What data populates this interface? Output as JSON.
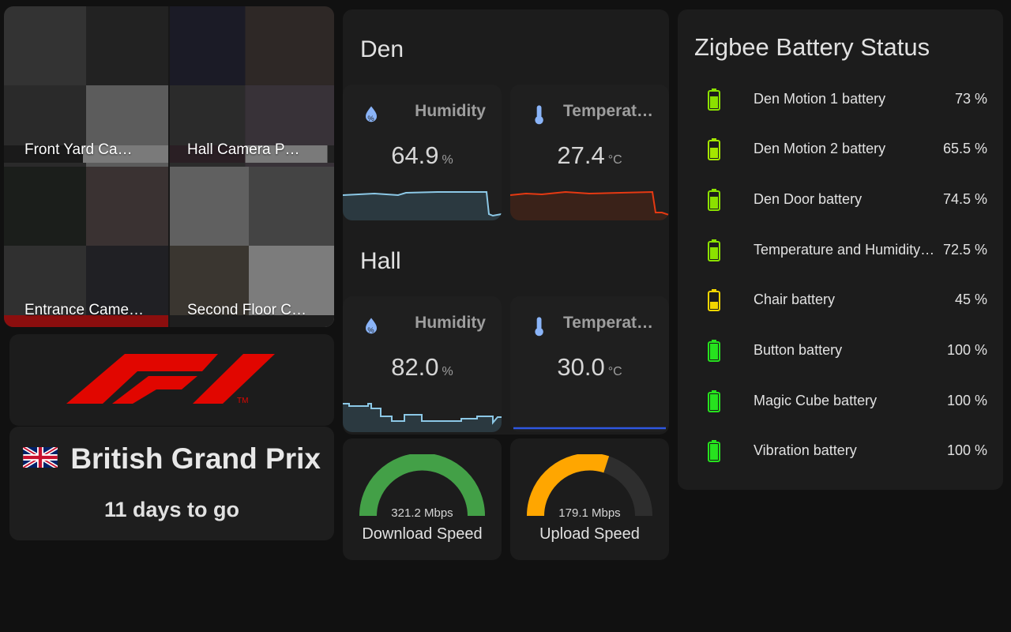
{
  "cameras": [
    {
      "label": "Front Yard Ca…"
    },
    {
      "label": "Hall Camera P…"
    },
    {
      "label": "Entrance Came…"
    },
    {
      "label": "Second Floor C…"
    }
  ],
  "race": {
    "name": "British Grand Prix",
    "countdown": "11 days to go",
    "logo_trademark": "TM",
    "logo_name": "F1",
    "flag": "uk-flag-icon",
    "brand_color": "#e10600"
  },
  "areas": [
    {
      "title": "Den",
      "sensors": [
        {
          "name": "Humidity",
          "value": "64.9",
          "unit": "%",
          "icon": "humidity-icon",
          "color": "#8cc8e6"
        },
        {
          "name": "Temperat…",
          "value": "27.4",
          "unit": "°C",
          "icon": "thermometer-icon",
          "color": "#e53912"
        }
      ]
    },
    {
      "title": "Hall",
      "sensors": [
        {
          "name": "Humidity",
          "value": "82.0",
          "unit": "%",
          "icon": "humidity-icon",
          "color": "#8cc8e6"
        },
        {
          "name": "Temperat…",
          "value": "30.0",
          "unit": "°C",
          "icon": "thermometer-icon",
          "color": "#2f57e0"
        }
      ]
    }
  ],
  "speed": {
    "download": {
      "value": "321.2 Mbps",
      "label": "Download Speed",
      "fraction": 1.0,
      "color": "#43a047"
    },
    "upload": {
      "value": "179.1 Mbps",
      "label": "Upload Speed",
      "fraction": 0.6,
      "color": "#ffa600"
    }
  },
  "battery": {
    "title": "Zigbee Battery Status",
    "items": [
      {
        "name": "Den Motion 1 battery",
        "value": "73 %",
        "level": 73,
        "color": "#8be100"
      },
      {
        "name": "Den Motion 2 battery",
        "value": "65.5 %",
        "level": 65.5,
        "color": "#a4e600"
      },
      {
        "name": "Den Door battery",
        "value": "74.5 %",
        "level": 74.5,
        "color": "#8be100"
      },
      {
        "name": "Temperature and Humidity…",
        "value": "72.5 %",
        "level": 72.5,
        "color": "#8be100"
      },
      {
        "name": "Chair battery",
        "value": "45 %",
        "level": 45,
        "color": "#f2d600"
      },
      {
        "name": "Button battery",
        "value": "100 %",
        "level": 100,
        "color": "#26e21e"
      },
      {
        "name": "Magic Cube battery",
        "value": "100 %",
        "level": 100,
        "color": "#26e21e"
      },
      {
        "name": "Vibration battery",
        "value": "100 %",
        "level": 100,
        "color": "#26e21e"
      }
    ]
  }
}
